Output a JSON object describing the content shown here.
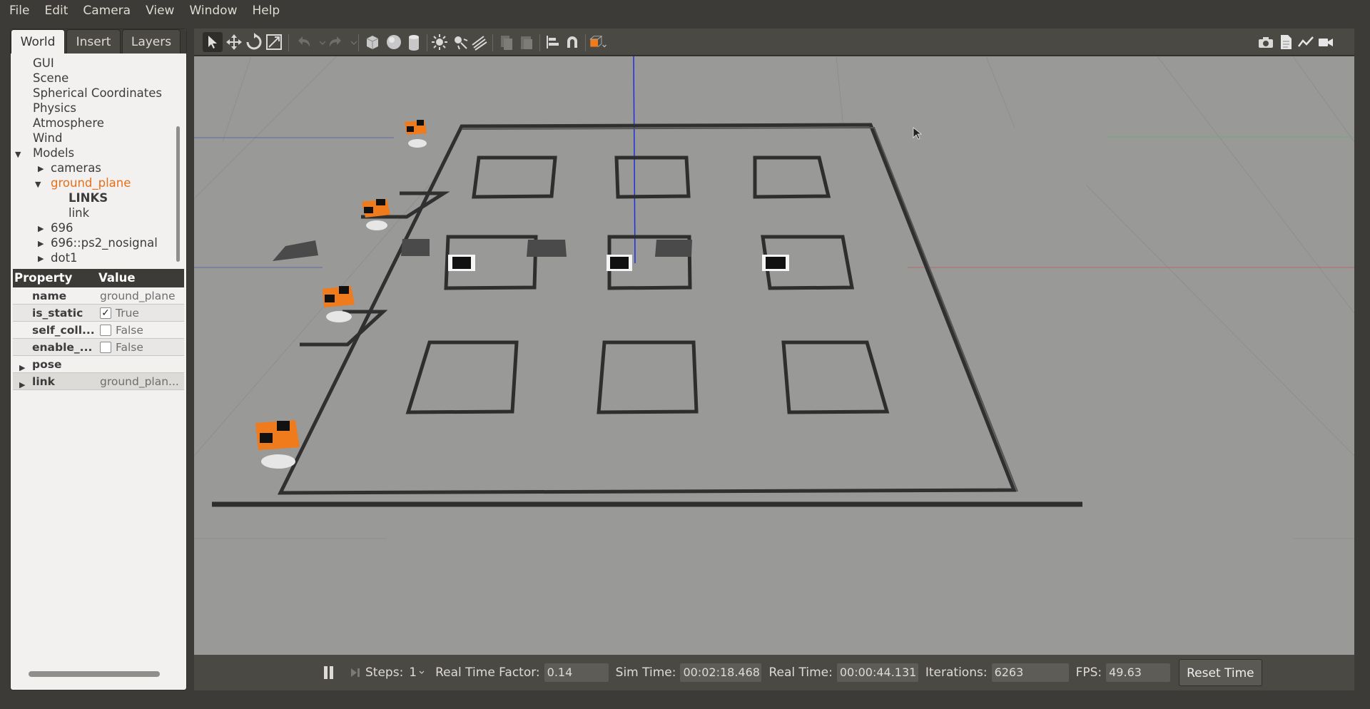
{
  "menu": [
    "File",
    "Edit",
    "Camera",
    "View",
    "Window",
    "Help"
  ],
  "tabs": [
    "World",
    "Insert",
    "Layers"
  ],
  "tree": [
    {
      "label": "GUI"
    },
    {
      "label": "Scene"
    },
    {
      "label": "Spherical Coordinates"
    },
    {
      "label": "Physics"
    },
    {
      "label": "Atmosphere"
    },
    {
      "label": "Wind"
    },
    {
      "label": "Models"
    },
    {
      "label": "cameras"
    },
    {
      "label": "ground_plane"
    },
    {
      "label": "LINKS"
    },
    {
      "label": "link"
    },
    {
      "label": "696"
    },
    {
      "label": "696::ps2_nosignal"
    },
    {
      "label": "dot1"
    }
  ],
  "properties": {
    "header": {
      "property": "Property",
      "value": "Value"
    },
    "rows": [
      {
        "key": "name",
        "value": "ground_plane"
      },
      {
        "key": "is_static",
        "value": "True"
      },
      {
        "key": "self_coll...",
        "value": "False"
      },
      {
        "key": "enable_...",
        "value": "False"
      },
      {
        "key": "pose",
        "value": ""
      },
      {
        "key": "link",
        "value": "ground_plan..."
      }
    ]
  },
  "bottom": {
    "steps_label": "Steps:",
    "steps_value": "1",
    "rtf_label": "Real Time Factor:",
    "rtf_value": "0.14",
    "sim_label": "Sim Time:",
    "sim_value": "00:02:18.468",
    "real_label": "Real Time:",
    "real_value": "00:00:44.131",
    "iter_label": "Iterations:",
    "iter_value": "6263",
    "fps_label": "FPS:",
    "fps_value": "49.63",
    "reset_label": "Reset Time"
  },
  "colors": {
    "accent": "#f07b1c",
    "panel_bg": "#f2f1f0",
    "chrome": "#3c3b37",
    "ground": "#999998",
    "wall": "#2e2e2e"
  }
}
